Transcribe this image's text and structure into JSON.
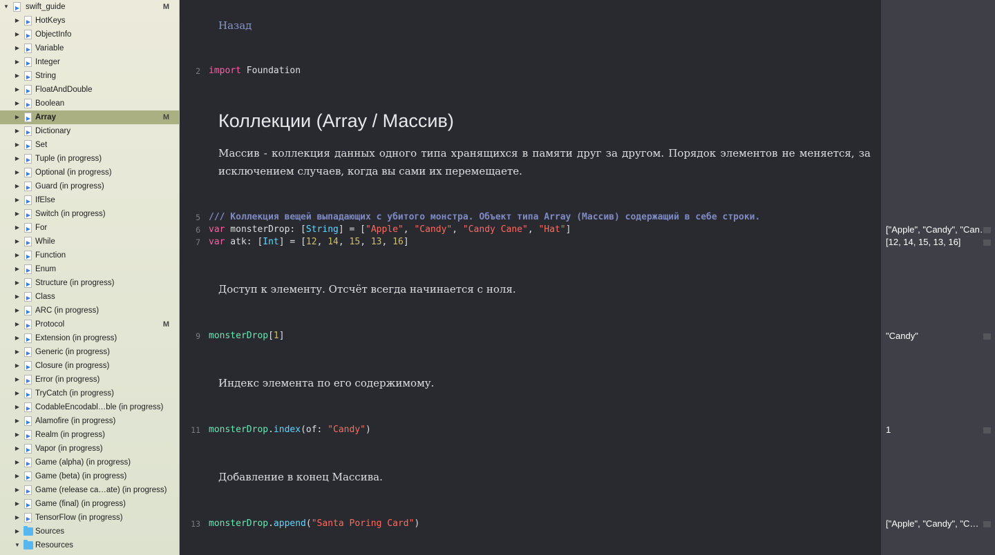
{
  "sidebar": {
    "root": {
      "label": "swift_guide",
      "badge": "M"
    },
    "items": [
      {
        "label": "HotKeys",
        "badge": ""
      },
      {
        "label": "ObjectInfo",
        "badge": ""
      },
      {
        "label": "Variable",
        "badge": ""
      },
      {
        "label": "Integer",
        "badge": ""
      },
      {
        "label": "String",
        "badge": ""
      },
      {
        "label": "FloatAndDouble",
        "badge": ""
      },
      {
        "label": "Boolean",
        "badge": ""
      },
      {
        "label": "Array",
        "badge": "M",
        "selected": true
      },
      {
        "label": "Dictionary",
        "badge": ""
      },
      {
        "label": "Set",
        "badge": ""
      },
      {
        "label": "Tuple (in progress)",
        "badge": ""
      },
      {
        "label": "Optional (in progress)",
        "badge": ""
      },
      {
        "label": "Guard (in progress)",
        "badge": ""
      },
      {
        "label": "IfElse",
        "badge": ""
      },
      {
        "label": "Switch (in progress)",
        "badge": ""
      },
      {
        "label": "For",
        "badge": ""
      },
      {
        "label": "While",
        "badge": ""
      },
      {
        "label": "Function",
        "badge": ""
      },
      {
        "label": "Enum",
        "badge": ""
      },
      {
        "label": "Structure (in progress)",
        "badge": ""
      },
      {
        "label": "Class",
        "badge": ""
      },
      {
        "label": "ARC (in progress)",
        "badge": ""
      },
      {
        "label": "Protocol",
        "badge": "M"
      },
      {
        "label": "Extension (in progress)",
        "badge": ""
      },
      {
        "label": "Generic (in progress)",
        "badge": ""
      },
      {
        "label": "Closure (in progress)",
        "badge": ""
      },
      {
        "label": "Error (in progress)",
        "badge": ""
      },
      {
        "label": "TryCatch (in progress)",
        "badge": ""
      },
      {
        "label": "CodableEncodabl…ble (in progress)",
        "badge": ""
      },
      {
        "label": "Alamofire (in progress)",
        "badge": ""
      },
      {
        "label": "Realm (in progress)",
        "badge": ""
      },
      {
        "label": "Vapor (in progress)",
        "badge": ""
      },
      {
        "label": "Game (alpha) (in progress)",
        "badge": ""
      },
      {
        "label": "Game (beta) (in progress)",
        "badge": ""
      },
      {
        "label": "Game (release ca…ate) (in progress)",
        "badge": ""
      },
      {
        "label": "Game (final) (in progress)",
        "badge": ""
      },
      {
        "label": "TensorFlow (in progress)",
        "badge": ""
      }
    ],
    "folders": [
      {
        "label": "Sources"
      },
      {
        "label": "Resources"
      }
    ]
  },
  "editor": {
    "back_link": "Назад",
    "heading": "Коллекции (Array / Массив)",
    "intro": "Массив - коллекция данных одного типа хранящихся в памяти друг за другом. Порядок элементов не меняется, за исключением случаев, когда вы сами их перемещаете.",
    "access_text": "Доступ к элементу. Отсчёт всегда начинается с ноля.",
    "index_text": "Индекс элемента по его содержимому.",
    "append_text": "Добавление в конец Массива.",
    "line_numbers": {
      "l2": "2",
      "l5": "5",
      "l6": "6",
      "l7": "7",
      "l9": "9",
      "l11": "11",
      "l13": "13"
    },
    "code": {
      "l2_kw": "import",
      "l2_rest": " Foundation",
      "l5_comment": "/// Коллекция вещей выпадающих с убитого монстра. Объект типа Array (Массив) содержащий в себе строки.",
      "l6_kw": "var",
      "l6_a": " monsterDrop: [",
      "l6_type": "String",
      "l6_b": "] = [",
      "l6_s1": "\"Apple\"",
      "l6_s2": "\"Candy\"",
      "l6_s3": "\"Candy Cane\"",
      "l6_s4": "\"Hat\"",
      "l6_c": "]",
      "sep": ", ",
      "l7_kw": "var",
      "l7_a": " atk: [",
      "l7_type": "Int",
      "l7_b": "] = [",
      "l7_n1": "12",
      "l7_n2": "14",
      "l7_n3": "15",
      "l7_n4": "13",
      "l7_n5": "16",
      "l7_c": "]",
      "l9_id": "monsterDrop",
      "l9_a": "[",
      "l9_n": "1",
      "l9_b": "]",
      "l11_id": "monsterDrop",
      "l11_dot": ".",
      "l11_fn": "index",
      "l11_a": "(of: ",
      "l11_s": "\"Candy\"",
      "l11_b": ")",
      "l13_id": "monsterDrop",
      "l13_dot": ".",
      "l13_fn": "append",
      "l13_a": "(",
      "l13_s": "\"Santa Poring Card\"",
      "l13_b": ")"
    }
  },
  "results": {
    "r6": "[\"Apple\", \"Candy\", \"Can…",
    "r7": "[12, 14, 15, 13, 16]",
    "r9": "\"Candy\"",
    "r11": "1",
    "r13": "[\"Apple\", \"Candy\", \"C…"
  }
}
